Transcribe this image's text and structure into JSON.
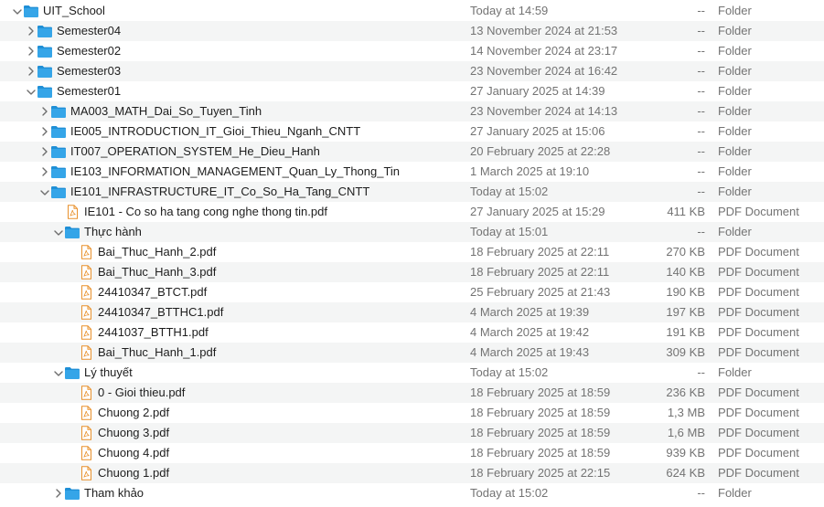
{
  "colors": {
    "folder": "#35a5e8",
    "folder_dark": "#1f8fd6",
    "pdf_outline": "#e8902b",
    "text_secondary": "#737373",
    "stripe": "#f4f5f5"
  },
  "rows": [
    {
      "name": "UIT_School",
      "date": "Today at 14:59",
      "size": "--",
      "kind": "Folder",
      "type": "folder",
      "depth": 0,
      "expanded": true
    },
    {
      "name": "Semester04",
      "date": "13 November 2024 at 21:53",
      "size": "--",
      "kind": "Folder",
      "type": "folder",
      "depth": 1,
      "expanded": false
    },
    {
      "name": "Semester02",
      "date": "14 November 2024 at 23:17",
      "size": "--",
      "kind": "Folder",
      "type": "folder",
      "depth": 1,
      "expanded": false
    },
    {
      "name": "Semester03",
      "date": "23 November 2024 at 16:42",
      "size": "--",
      "kind": "Folder",
      "type": "folder",
      "depth": 1,
      "expanded": false
    },
    {
      "name": "Semester01",
      "date": "27 January 2025 at 14:39",
      "size": "--",
      "kind": "Folder",
      "type": "folder",
      "depth": 1,
      "expanded": true
    },
    {
      "name": "MA003_MATH_Dai_So_Tuyen_Tinh",
      "date": "23 November 2024 at 14:13",
      "size": "--",
      "kind": "Folder",
      "type": "folder",
      "depth": 2,
      "expanded": false
    },
    {
      "name": "IE005_INTRODUCTION_IT_Gioi_Thieu_Nganh_CNTT",
      "date": "27 January 2025 at 15:06",
      "size": "--",
      "kind": "Folder",
      "type": "folder",
      "depth": 2,
      "expanded": false
    },
    {
      "name": "IT007_OPERATION_SYSTEM_He_Dieu_Hanh",
      "date": "20 February 2025 at 22:28",
      "size": "--",
      "kind": "Folder",
      "type": "folder",
      "depth": 2,
      "expanded": false
    },
    {
      "name": "IE103_INFORMATION_MANAGEMENT_Quan_Ly_Thong_Tin",
      "date": "1 March 2025 at 19:10",
      "size": "--",
      "kind": "Folder",
      "type": "folder",
      "depth": 2,
      "expanded": false
    },
    {
      "name": "IE101_INFRASTRUCTURE_IT_Co_So_Ha_Tang_CNTT",
      "date": "Today at 15:02",
      "size": "--",
      "kind": "Folder",
      "type": "folder",
      "depth": 2,
      "expanded": true
    },
    {
      "name": "IE101 - Co so ha tang cong nghe thong tin.pdf",
      "date": "27 January 2025 at 15:29",
      "size": "411 KB",
      "kind": "PDF Document",
      "type": "pdf",
      "depth": 3
    },
    {
      "name": "Thực hành",
      "date": "Today at 15:01",
      "size": "--",
      "kind": "Folder",
      "type": "folder",
      "depth": 3,
      "expanded": true
    },
    {
      "name": "Bai_Thuc_Hanh_2.pdf",
      "date": "18 February 2025 at 22:11",
      "size": "270 KB",
      "kind": "PDF Document",
      "type": "pdf",
      "depth": 4
    },
    {
      "name": "Bai_Thuc_Hanh_3.pdf",
      "date": "18 February 2025 at 22:11",
      "size": "140 KB",
      "kind": "PDF Document",
      "type": "pdf",
      "depth": 4
    },
    {
      "name": "24410347_BTCT.pdf",
      "date": "25 February 2025 at 21:43",
      "size": "190 KB",
      "kind": "PDF Document",
      "type": "pdf",
      "depth": 4
    },
    {
      "name": "24410347_BTTHC1.pdf",
      "date": "4 March 2025 at 19:39",
      "size": "197 KB",
      "kind": "PDF Document",
      "type": "pdf",
      "depth": 4
    },
    {
      "name": "2441037_BTTH1.pdf",
      "date": "4 March 2025 at 19:42",
      "size": "191 KB",
      "kind": "PDF Document",
      "type": "pdf",
      "depth": 4
    },
    {
      "name": "Bai_Thuc_Hanh_1.pdf",
      "date": "4 March 2025 at 19:43",
      "size": "309 KB",
      "kind": "PDF Document",
      "type": "pdf",
      "depth": 4
    },
    {
      "name": "Lý thuyết",
      "date": "Today at 15:02",
      "size": "--",
      "kind": "Folder",
      "type": "folder",
      "depth": 3,
      "expanded": true
    },
    {
      "name": "0 - Gioi thieu.pdf",
      "date": "18 February 2025 at 18:59",
      "size": "236 KB",
      "kind": "PDF Document",
      "type": "pdf",
      "depth": 4
    },
    {
      "name": "Chuong 2.pdf",
      "date": "18 February 2025 at 18:59",
      "size": "1,3 MB",
      "kind": "PDF Document",
      "type": "pdf",
      "depth": 4
    },
    {
      "name": "Chuong 3.pdf",
      "date": "18 February 2025 at 18:59",
      "size": "1,6 MB",
      "kind": "PDF Document",
      "type": "pdf",
      "depth": 4
    },
    {
      "name": "Chuong 4.pdf",
      "date": "18 February 2025 at 18:59",
      "size": "939 KB",
      "kind": "PDF Document",
      "type": "pdf",
      "depth": 4
    },
    {
      "name": "Chuong 1.pdf",
      "date": "18 February 2025 at 22:15",
      "size": "624 KB",
      "kind": "PDF Document",
      "type": "pdf",
      "depth": 4
    },
    {
      "name": "Tham khảo",
      "date": "Today at 15:02",
      "size": "--",
      "kind": "Folder",
      "type": "folder",
      "depth": 3,
      "expanded": false
    }
  ]
}
